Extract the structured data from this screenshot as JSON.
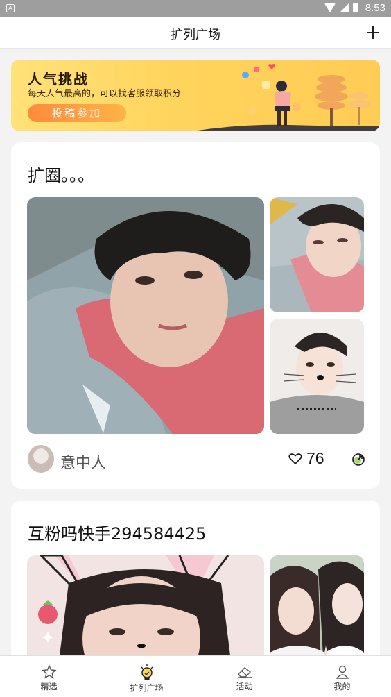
{
  "status_bar": {
    "notification_icon": "notification-icon",
    "time": "8:53"
  },
  "header": {
    "title": "扩列广场",
    "add_icon": "plus-icon"
  },
  "banner": {
    "title": "人气挑战",
    "subtitle": "每天人气最高的，可以找客服领取积分",
    "button_label": "投稿参加",
    "accent": "#ffd45c"
  },
  "posts": [
    {
      "title": "扩圈。。。",
      "author": "意中人",
      "likes": "76",
      "photos": [
        "boy-red-shirt-main",
        "boy-red-shirt-side",
        "boy-gray-shirt-filter"
      ]
    },
    {
      "title": "互粉吗快手294584425",
      "photos": [
        "girl-cat-ear-filter",
        "two-girls-outdoor"
      ]
    }
  ],
  "bottom_nav": {
    "items": [
      {
        "label": "精选",
        "icon": "star-icon",
        "active": false
      },
      {
        "label": "扩列广场",
        "icon": "bulb-icon",
        "active": true
      },
      {
        "label": "活动",
        "icon": "eraser-icon",
        "active": false
      },
      {
        "label": "我的",
        "icon": "person-icon",
        "active": false
      }
    ]
  }
}
